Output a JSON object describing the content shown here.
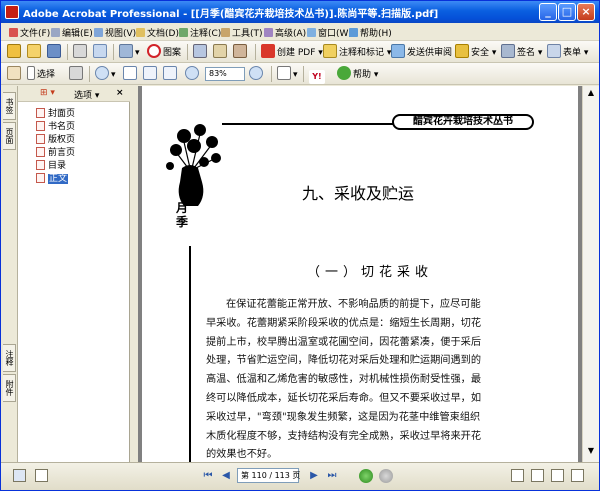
{
  "window": {
    "title": "Adobe Acrobat Professional - [[月季(醋宾花卉栽培技术丛书)].陈尚平等.扫描版.pdf]",
    "minimize": "_",
    "maximize": "□",
    "close": "×"
  },
  "menu": [
    {
      "label": "文件(F)",
      "icon": "file-icon"
    },
    {
      "label": "编辑(E)",
      "icon": "edit-icon"
    },
    {
      "label": "视图(V)",
      "icon": "view-icon"
    },
    {
      "label": "文档(D)",
      "icon": "document-icon"
    },
    {
      "label": "注释(C)",
      "icon": "comment-icon"
    },
    {
      "label": "工具(T)",
      "icon": "tools-icon"
    },
    {
      "label": "高级(A)",
      "icon": "advanced-icon"
    },
    {
      "label": "窗口(W)",
      "icon": "window-icon"
    },
    {
      "label": "帮助(H)",
      "icon": "help-icon"
    }
  ],
  "toolbar1": {
    "label_1": "图案",
    "create_pdf": "创建 PDF",
    "comment_markup": "注释和标记",
    "send_review": "发送供审阅",
    "secure": "安全",
    "sign": "签名",
    "forms": "表单"
  },
  "toolbar2": {
    "select": "选择",
    "zoom_value": "83%",
    "help": "帮助"
  },
  "left_tabs": [
    "书签",
    "页面",
    "注释",
    "附件"
  ],
  "bookmarks_panel": {
    "options": "选项",
    "close": "×",
    "items": [
      {
        "label": "封面页",
        "selected": false
      },
      {
        "label": "书名页",
        "selected": false
      },
      {
        "label": "版权页",
        "selected": false
      },
      {
        "label": "前言页",
        "selected": false
      },
      {
        "label": "目录",
        "selected": false
      },
      {
        "label": "正文",
        "selected": true
      }
    ]
  },
  "document": {
    "series_title": "醋宾花卉栽培技术丛书",
    "side_label": "月季",
    "chapter_title": "九、采收及贮运",
    "section_title": "（一）切花采收",
    "lines": [
      "在保证花蕾能正常开放、不影响品质的前提下，应尽可能",
      "早采收。花蕾期紧采阶段采收的优点是：缩短生长周期，切花",
      "提前上市，校早腾出温室或花圃空间，因花蕾紧凑，便于采后",
      "处理，节省贮运空间，降低切花对采后处理和贮运期间遇到的",
      "高温、低温和乙烯危害的敏感性，对机械性损伤耐受性强，最",
      "终可以降低成本，延长切花采后寿命。但又不要采收过早，如",
      "采收过早，\"弯颈\"现象发生频繁，这是因为花茎中维管束组织",
      "木质化程度不够，支持结构没有完全成熟，采收过早将来开花",
      "的效果也不好。"
    ]
  },
  "statusbar": {
    "page_indicator": "第 110 / 113 页"
  },
  "colors": {
    "titlebar": "#0a5fe0",
    "selection": "#316ac5",
    "doc_background": "#808080"
  }
}
